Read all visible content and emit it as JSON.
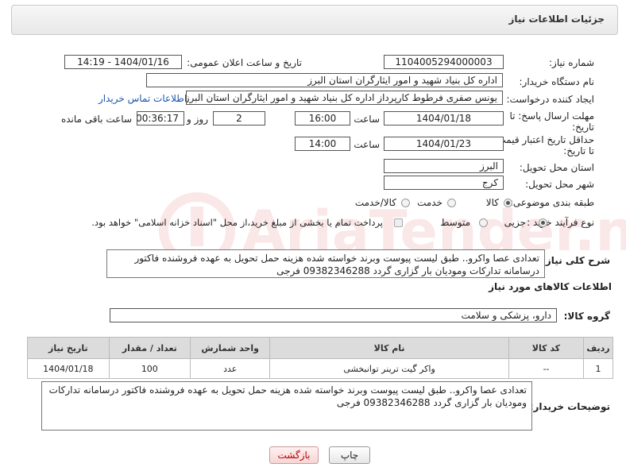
{
  "header": {
    "title": "جزئیات اطلاعات نیاز"
  },
  "watermark": {
    "text": "AriaTender.net"
  },
  "need_number": {
    "label": "شماره نیاز:",
    "value": "1104005294000003"
  },
  "announce": {
    "label": "تاریخ و ساعت اعلان عمومی:",
    "value": "1404/01/16 - 14:19"
  },
  "buyer_org": {
    "label": "نام دستگاه خریدار:",
    "value": "اداره کل بنیاد شهید و امور ایثارگران استان البرز"
  },
  "requester": {
    "label": "ایجاد کننده درخواست:",
    "value": "یونس  صفری فرطوط کارپرداز اداره کل بنیاد شهید و امور ایثارگران استان البرز",
    "contact_link": "اطلاعات تماس خریدار"
  },
  "deadline": {
    "label_line1": "مهلت ارسال پاسخ: تا",
    "label_line2": "تاریخ:",
    "date": "1404/01/18",
    "time_label": "ساعت",
    "time": "16:00",
    "days": "2",
    "days_label": "روز و",
    "remaining": "00:36:17",
    "remaining_label": "ساعت باقی مانده"
  },
  "validity": {
    "label_line1": "حداقل تاریخ اعتبار قیمت:",
    "label_line2": "تا تاریخ:",
    "date": "1404/01/23",
    "time_label": "ساعت",
    "time": "14:00"
  },
  "province": {
    "label": "استان محل تحویل:",
    "value": "البرز"
  },
  "city": {
    "label": "شهر محل تحویل:",
    "value": "کرج"
  },
  "category": {
    "label": "طبقه بندی موضوعی:",
    "options": [
      "کالا",
      "خدمت",
      "کالا/خدمت"
    ]
  },
  "process": {
    "label": "نوع فرآیند خرید :",
    "options": [
      "جزیی",
      "متوسط"
    ],
    "note": "پرداخت تمام یا بخشی از مبلغ خرید،از محل \"اسناد خزانه اسلامی\" خواهد بود."
  },
  "description": {
    "label": "شرح کلی نیاز:",
    "value": "تعدادی عصا واکرو.. طبق  لیست پیوست وبرند خواسته شده هزینه حمل تحویل به عهده فروشنده فاکتور درسامانه تدارکات ومودیان بار گزاری گردد 09382346288 فرجی"
  },
  "goods_info": {
    "title": "اطلاعات کالاهای مورد نیاز"
  },
  "goods_group": {
    "label": "گروه کالا:",
    "value": "دارو، پزشکی و سلامت"
  },
  "table": {
    "headers": [
      "ردیف",
      "کد کالا",
      "نام کالا",
      "واحد شمارش",
      "تعداد / مقدار",
      "تاریخ نیاز"
    ],
    "rows": [
      [
        "1",
        "--",
        "واکر گیت ترینر توانبخشی",
        "عدد",
        "100",
        "1404/01/18"
      ]
    ]
  },
  "buyer_notes": {
    "label": "توضیحات خریدار:",
    "value": "تعدادی عصا واکرو.. طبق  لیست پیوست وبرند خواسته شده هزینه حمل تحویل به عهده فروشنده فاکتور درسامانه تدارکات ومودیان بار گزاری گردد 09382346288 فرجی"
  },
  "buttons": {
    "print": "چاپ",
    "back": "بازگشت"
  }
}
